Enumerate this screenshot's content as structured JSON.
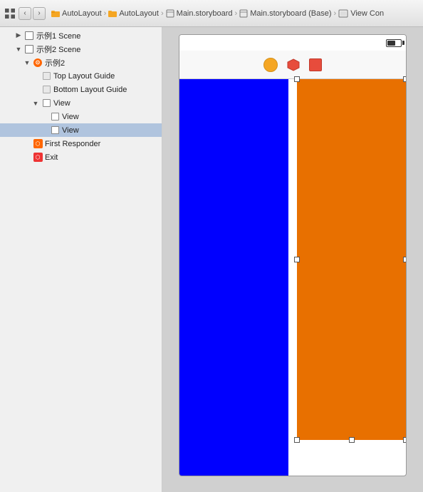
{
  "toolbar": {
    "breadcrumbs": [
      {
        "label": "AutoLayout",
        "icon": "folder"
      },
      {
        "label": "AutoLayout",
        "icon": "folder"
      },
      {
        "label": "Main.storyboard",
        "icon": "file"
      },
      {
        "label": "Main.storyboard (Base)",
        "icon": "file"
      },
      {
        "label": "View Con",
        "icon": "viewcon"
      }
    ]
  },
  "sidebar": {
    "scene1": {
      "label": "示例1 Scene",
      "collapsed": true
    },
    "scene2": {
      "label": "示例2 Scene",
      "items": {
        "example2": "示例2",
        "topLayoutGuide": "Top Layout Guide",
        "bottomLayoutGuide": "Bottom Layout Guide",
        "view": "View",
        "viewChild1": "View",
        "viewChild2": "View",
        "firstResponder": "First Responder",
        "exit": "Exit"
      }
    }
  },
  "canvas": {
    "toolbar_buttons": [
      {
        "color": "#f5a623",
        "label": "orange-button"
      },
      {
        "color": "#e74c3c",
        "label": "red-circle-button"
      },
      {
        "color": "#e74c3c",
        "label": "red-square-button"
      }
    ],
    "blue_view_color": "#0000ff",
    "orange_view_color": "#e87000"
  }
}
